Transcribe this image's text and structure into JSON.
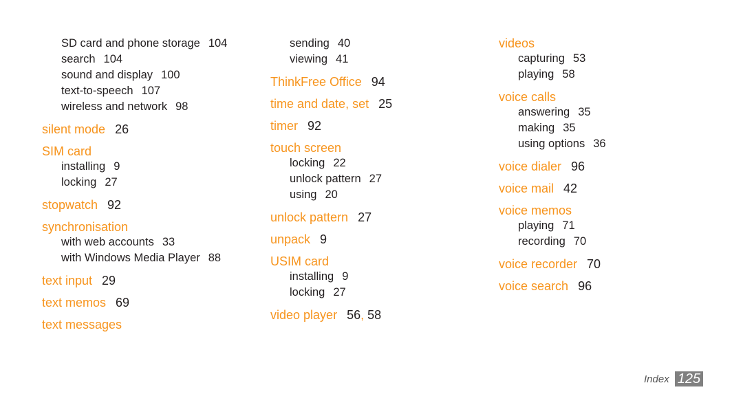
{
  "columns": [
    {
      "entries": [
        {
          "sub": true,
          "label": "SD card and phone storage",
          "pages": "104"
        },
        {
          "sub": true,
          "label": "search",
          "pages": "104"
        },
        {
          "sub": true,
          "label": "sound and display",
          "pages": "100"
        },
        {
          "sub": true,
          "label": "text-to-speech",
          "pages": "107"
        },
        {
          "sub": true,
          "label": "wireless and network",
          "pages": "98"
        },
        {
          "sub": false,
          "label": "silent mode",
          "pages": "26"
        },
        {
          "sub": false,
          "label": "SIM card",
          "pages": ""
        },
        {
          "sub": true,
          "label": "installing",
          "pages": "9"
        },
        {
          "sub": true,
          "label": "locking",
          "pages": "27"
        },
        {
          "sub": false,
          "label": "stopwatch",
          "pages": "92"
        },
        {
          "sub": false,
          "label": "synchronisation",
          "pages": ""
        },
        {
          "sub": true,
          "label": "with web accounts",
          "pages": "33"
        },
        {
          "sub": true,
          "label": "with Windows Media Player",
          "pages": "88"
        },
        {
          "sub": false,
          "label": "text input",
          "pages": "29"
        },
        {
          "sub": false,
          "label": "text memos",
          "pages": "69"
        },
        {
          "sub": false,
          "label": "text messages",
          "pages": ""
        }
      ]
    },
    {
      "entries": [
        {
          "sub": true,
          "label": "sending",
          "pages": "40"
        },
        {
          "sub": true,
          "label": "viewing",
          "pages": "41"
        },
        {
          "sub": false,
          "label": "ThinkFree Office",
          "pages": "94"
        },
        {
          "sub": false,
          "label": "time and date, set",
          "pages": "25"
        },
        {
          "sub": false,
          "label": "timer",
          "pages": "92"
        },
        {
          "sub": false,
          "label": "touch screen",
          "pages": ""
        },
        {
          "sub": true,
          "label": "locking",
          "pages": "22"
        },
        {
          "sub": true,
          "label": "unlock pattern",
          "pages": "27"
        },
        {
          "sub": true,
          "label": "using",
          "pages": "20"
        },
        {
          "sub": false,
          "label": "unlock pattern",
          "pages": "27"
        },
        {
          "sub": false,
          "label": "unpack",
          "pages": "9"
        },
        {
          "sub": false,
          "label": "USIM card",
          "pages": ""
        },
        {
          "sub": true,
          "label": "installing",
          "pages": "9"
        },
        {
          "sub": true,
          "label": "locking",
          "pages": "27"
        },
        {
          "sub": false,
          "label": "video player",
          "pages": "56, 58"
        }
      ]
    },
    {
      "entries": [
        {
          "sub": false,
          "label": "videos",
          "pages": ""
        },
        {
          "sub": true,
          "label": "capturing",
          "pages": "53"
        },
        {
          "sub": true,
          "label": "playing",
          "pages": "58"
        },
        {
          "sub": false,
          "label": "voice calls",
          "pages": ""
        },
        {
          "sub": true,
          "label": "answering",
          "pages": "35"
        },
        {
          "sub": true,
          "label": "making",
          "pages": "35"
        },
        {
          "sub": true,
          "label": "using options",
          "pages": "36"
        },
        {
          "sub": false,
          "label": "voice dialer",
          "pages": "96"
        },
        {
          "sub": false,
          "label": "voice mail",
          "pages": "42"
        },
        {
          "sub": false,
          "label": "voice memos",
          "pages": ""
        },
        {
          "sub": true,
          "label": "playing",
          "pages": "71"
        },
        {
          "sub": true,
          "label": "recording",
          "pages": "70"
        },
        {
          "sub": false,
          "label": "voice recorder",
          "pages": "70"
        },
        {
          "sub": false,
          "label": "voice search",
          "pages": "96"
        }
      ]
    }
  ],
  "footer": {
    "label": "Index",
    "page": "125"
  },
  "colors": {
    "accent": "#f7941d",
    "text": "#231f20",
    "page_badge": "#808080"
  }
}
